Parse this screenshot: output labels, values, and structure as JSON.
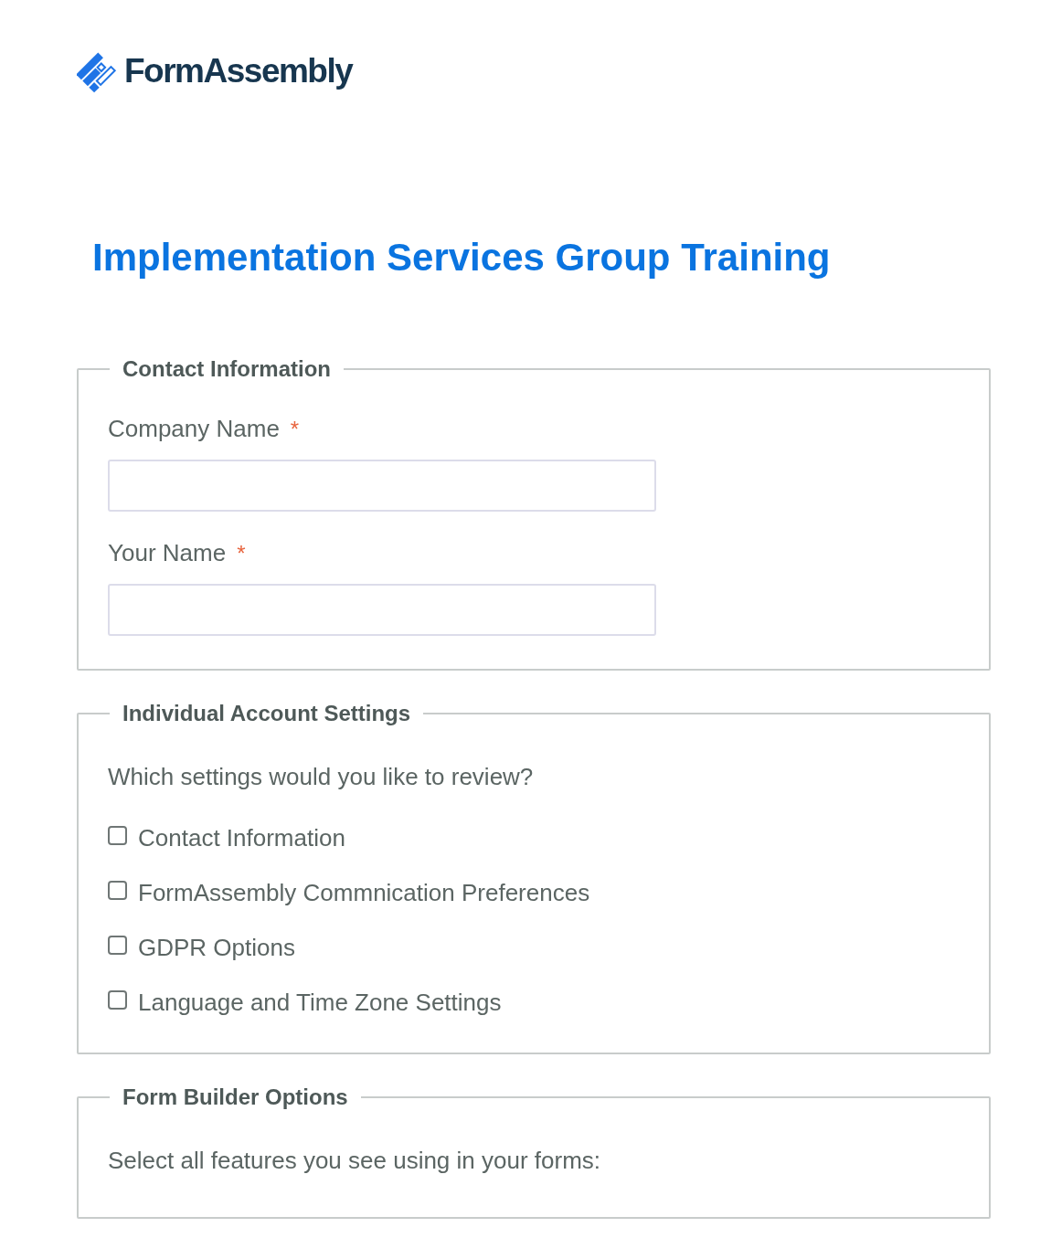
{
  "logo": {
    "text": "FormAssembly"
  },
  "title": "Implementation Services Group Training",
  "sections": [
    {
      "legend": "Contact Information",
      "items": [
        {
          "kind": "text",
          "label": "Company Name",
          "required_mark": "*"
        },
        {
          "kind": "text",
          "label": "Your Name",
          "required_mark": "*"
        }
      ]
    },
    {
      "legend": "Individual Account Settings",
      "items": [
        {
          "kind": "question",
          "text": "Which settings would you like to review?"
        },
        {
          "kind": "checkbox",
          "label": "Contact Information",
          "checked": false
        },
        {
          "kind": "checkbox",
          "label": "FormAssembly Commnication Preferences",
          "checked": false
        },
        {
          "kind": "checkbox",
          "label": "GDPR Options",
          "checked": false
        },
        {
          "kind": "checkbox",
          "label": "Language and Time Zone Settings",
          "checked": false
        }
      ]
    },
    {
      "legend": "Form Builder Options",
      "items": [
        {
          "kind": "question",
          "text": "Select all features you see using in your forms:"
        }
      ]
    }
  ]
}
